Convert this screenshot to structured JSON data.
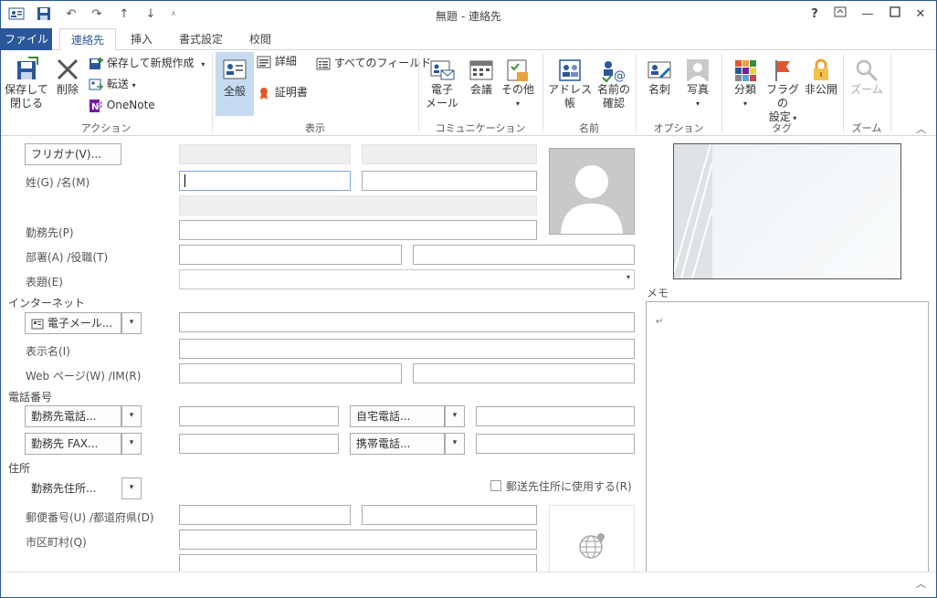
{
  "window": {
    "title": "無題 - 連絡先",
    "help": "?"
  },
  "tabs": [
    {
      "label": "ファイル"
    },
    {
      "label": "連絡先"
    },
    {
      "label": "挿入"
    },
    {
      "label": "書式設定"
    },
    {
      "label": "校閲"
    }
  ],
  "ribbon": {
    "actions": {
      "save_close": "保存して\n閉じる",
      "save_close_l1": "保存して",
      "save_close_l2": "閉じる",
      "delete": "削除",
      "save_new": "保存して新規作成",
      "forward": "転送",
      "onenote": "OneNote",
      "group": "アクション"
    },
    "show": {
      "general": "全般",
      "details": "詳細",
      "certificates": "証明書",
      "all_fields": "すべてのフィールド",
      "group": "表示"
    },
    "communicate": {
      "email_l1": "電子",
      "email_l2": "メール",
      "meeting": "会議",
      "more": "その他",
      "group": "コミュニケーション"
    },
    "names": {
      "address_book": "アドレス帳",
      "check_l1": "名前の",
      "check_l2": "確認",
      "group": "名前"
    },
    "options": {
      "business_card": "名刺",
      "picture": "写真",
      "group": "オプション"
    },
    "tags": {
      "categorize": "分類",
      "followup_l1": "フラグの",
      "followup_l2": "設定",
      "private": "非公開",
      "group": "タグ"
    },
    "zoom": {
      "zoom": "ズーム",
      "group": "ズーム"
    }
  },
  "form": {
    "furigana_btn": "フリガナ(V)...",
    "name_label": "姓(G)  /名(M)",
    "company_label": "勤務先(P)",
    "dept_label": "部署(A)  /役職(T)",
    "fileas_label": "表題(E)",
    "internet_section": "インターネット",
    "email_btn": "電子メール...",
    "display_label": "表示名(I)",
    "web_label": "Web ページ(W)  /IM(R)",
    "phone_section": "電話番号",
    "business_phone_btn": "勤務先電話...",
    "home_phone_btn": "自宅電話...",
    "business_fax_btn": "勤務先 FAX...",
    "mobile_btn": "携帯電話...",
    "address_section": "住所",
    "business_addr_btn": "勤務先住所...",
    "mailing_checkbox": "郵送先住所に使用する(R)",
    "postal_label": "郵便番号(U)  /都道府県(D)",
    "city_label": "市区町村(Q)",
    "notes_label": "メモ",
    "notes_mark": "↵"
  }
}
